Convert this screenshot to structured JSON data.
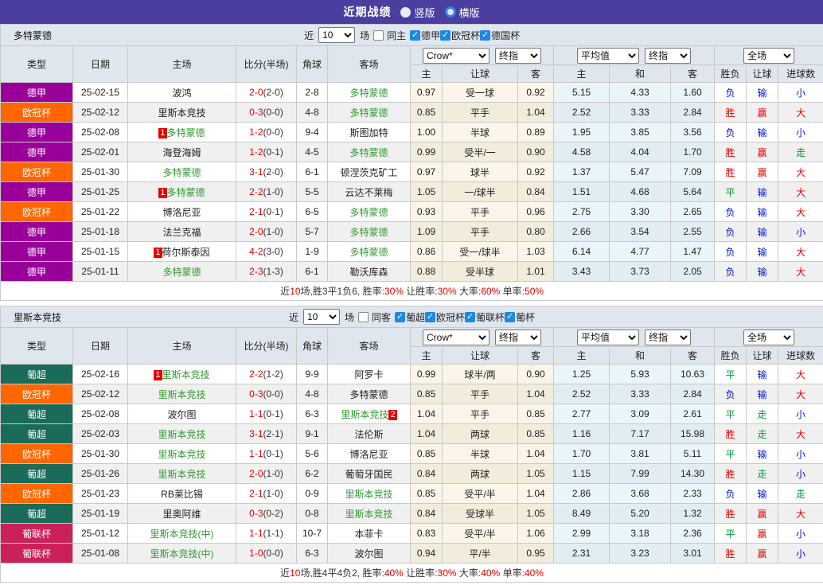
{
  "header": {
    "title": "近期战绩",
    "radios": [
      {
        "label": "竖版",
        "selected": true
      },
      {
        "label": "横版",
        "selected": false
      }
    ]
  },
  "league_colors": {
    "德甲": "#990099",
    "欧冠杯": "#ff6600",
    "葡超": "#1a6b5a",
    "葡联杯": "#cb2158"
  },
  "result_colors": {
    "red": "#e60000",
    "blue": "#0013cc",
    "green": "#009933"
  },
  "columns": {
    "type": "类型",
    "date": "日期",
    "home": "主场",
    "score": "比分(半场)",
    "corner": "角球",
    "away": "客场",
    "h": "主",
    "handicap": "让球",
    "a": "客",
    "avg_h": "主",
    "avg_d": "和",
    "avg_a": "客",
    "result": "胜负",
    "handicap_result": "让球",
    "goals": "进球数"
  },
  "header_selects": {
    "company": "Crow*",
    "company_final": "终指",
    "avg": "平均值",
    "avg_final": "终指",
    "scope": "全场"
  },
  "tables": [
    {
      "team": "多特蒙德",
      "filter": {
        "prefix": "近",
        "count": "10",
        "suffix": "场",
        "same_label": "同主",
        "leagues": [
          {
            "label": "德甲",
            "checked": true
          },
          {
            "label": "欧冠杯",
            "checked": true
          },
          {
            "label": "德国杯",
            "checked": true
          }
        ]
      },
      "rows": [
        {
          "league": "德甲",
          "date": "25-02-15",
          "home": "波鸿",
          "home_green": false,
          "home_badge": "",
          "score": "2-0",
          "half": "(2-0)",
          "corner": "2-8",
          "away": "多特蒙德",
          "away_green": true,
          "away_badge": "",
          "odds": [
            "0.97",
            "受一球",
            "0.92"
          ],
          "avg": [
            "5.15",
            "4.33",
            "1.60"
          ],
          "results": [
            {
              "t": "负",
              "c": "blue"
            },
            {
              "t": "输",
              "c": "blue"
            },
            {
              "t": "小",
              "c": "blue"
            }
          ]
        },
        {
          "league": "欧冠杯",
          "date": "25-02-12",
          "home": "里斯本竞技",
          "home_green": false,
          "home_badge": "",
          "score": "0-3",
          "half": "(0-0)",
          "corner": "4-8",
          "away": "多特蒙德",
          "away_green": true,
          "away_badge": "",
          "odds": [
            "0.85",
            "平手",
            "1.04"
          ],
          "avg": [
            "2.52",
            "3.33",
            "2.84"
          ],
          "results": [
            {
              "t": "胜",
              "c": "red"
            },
            {
              "t": "赢",
              "c": "red"
            },
            {
              "t": "大",
              "c": "red"
            }
          ]
        },
        {
          "league": "德甲",
          "date": "25-02-08",
          "home": "多特蒙德",
          "home_green": true,
          "home_badge": "1",
          "score": "1-2",
          "half": "(0-0)",
          "corner": "9-4",
          "away": "斯图加特",
          "away_green": false,
          "away_badge": "",
          "odds": [
            "1.00",
            "半球",
            "0.89"
          ],
          "avg": [
            "1.95",
            "3.85",
            "3.56"
          ],
          "results": [
            {
              "t": "负",
              "c": "blue"
            },
            {
              "t": "输",
              "c": "blue"
            },
            {
              "t": "小",
              "c": "blue"
            }
          ]
        },
        {
          "league": "德甲",
          "date": "25-02-01",
          "home": "海登海姆",
          "home_green": false,
          "home_badge": "",
          "score": "1-2",
          "half": "(0-1)",
          "corner": "4-5",
          "away": "多特蒙德",
          "away_green": true,
          "away_badge": "",
          "odds": [
            "0.99",
            "受半/一",
            "0.90"
          ],
          "avg": [
            "4.58",
            "4.04",
            "1.70"
          ],
          "results": [
            {
              "t": "胜",
              "c": "red"
            },
            {
              "t": "赢",
              "c": "red"
            },
            {
              "t": "走",
              "c": "green"
            }
          ]
        },
        {
          "league": "欧冠杯",
          "date": "25-01-30",
          "home": "多特蒙德",
          "home_green": true,
          "home_badge": "",
          "score": "3-1",
          "half": "(2-0)",
          "corner": "6-1",
          "away": "顿涅茨克矿工",
          "away_green": false,
          "away_badge": "",
          "odds": [
            "0.97",
            "球半",
            "0.92"
          ],
          "avg": [
            "1.37",
            "5.47",
            "7.09"
          ],
          "results": [
            {
              "t": "胜",
              "c": "red"
            },
            {
              "t": "赢",
              "c": "red"
            },
            {
              "t": "大",
              "c": "red"
            }
          ]
        },
        {
          "league": "德甲",
          "date": "25-01-25",
          "home": "多特蒙德",
          "home_green": true,
          "home_badge": "1",
          "score": "2-2",
          "half": "(1-0)",
          "corner": "5-5",
          "away": "云达不莱梅",
          "away_green": false,
          "away_badge": "",
          "odds": [
            "1.05",
            "一/球半",
            "0.84"
          ],
          "avg": [
            "1.51",
            "4.68",
            "5.64"
          ],
          "results": [
            {
              "t": "平",
              "c": "green"
            },
            {
              "t": "输",
              "c": "blue"
            },
            {
              "t": "大",
              "c": "red"
            }
          ]
        },
        {
          "league": "欧冠杯",
          "date": "25-01-22",
          "home": "博洛尼亚",
          "home_green": false,
          "home_badge": "",
          "score": "2-1",
          "half": "(0-1)",
          "corner": "6-5",
          "away": "多特蒙德",
          "away_green": true,
          "away_badge": "",
          "odds": [
            "0.93",
            "平手",
            "0.96"
          ],
          "avg": [
            "2.75",
            "3.30",
            "2.65"
          ],
          "results": [
            {
              "t": "负",
              "c": "blue"
            },
            {
              "t": "输",
              "c": "blue"
            },
            {
              "t": "大",
              "c": "red"
            }
          ]
        },
        {
          "league": "德甲",
          "date": "25-01-18",
          "home": "法兰克福",
          "home_green": false,
          "home_badge": "",
          "score": "2-0",
          "half": "(1-0)",
          "corner": "5-7",
          "away": "多特蒙德",
          "away_green": true,
          "away_badge": "",
          "odds": [
            "1.09",
            "平手",
            "0.80"
          ],
          "avg": [
            "2.66",
            "3.54",
            "2.55"
          ],
          "results": [
            {
              "t": "负",
              "c": "blue"
            },
            {
              "t": "输",
              "c": "blue"
            },
            {
              "t": "小",
              "c": "blue"
            }
          ]
        },
        {
          "league": "德甲",
          "date": "25-01-15",
          "home": "荷尔斯泰因",
          "home_green": false,
          "home_badge": "1",
          "score": "4-2",
          "half": "(3-0)",
          "corner": "1-9",
          "away": "多特蒙德",
          "away_green": true,
          "away_badge": "",
          "odds": [
            "0.86",
            "受一/球半",
            "1.03"
          ],
          "avg": [
            "6.14",
            "4.77",
            "1.47"
          ],
          "results": [
            {
              "t": "负",
              "c": "blue"
            },
            {
              "t": "输",
              "c": "blue"
            },
            {
              "t": "大",
              "c": "red"
            }
          ]
        },
        {
          "league": "德甲",
          "date": "25-01-11",
          "home": "多特蒙德",
          "home_green": true,
          "home_badge": "",
          "score": "2-3",
          "half": "(1-3)",
          "corner": "6-1",
          "away": "勒沃库森",
          "away_green": false,
          "away_badge": "",
          "odds": [
            "0.88",
            "受半球",
            "1.01"
          ],
          "avg": [
            "3.43",
            "3.73",
            "2.05"
          ],
          "results": [
            {
              "t": "负",
              "c": "blue"
            },
            {
              "t": "输",
              "c": "blue"
            },
            {
              "t": "大",
              "c": "red"
            }
          ]
        }
      ],
      "summary": [
        {
          "t": "近",
          "r": 0
        },
        {
          "t": "10",
          "r": 1
        },
        {
          "t": "场,胜3平1负6, 胜率:",
          "r": 0
        },
        {
          "t": "30%",
          "r": 1
        },
        {
          "t": " 让胜率:",
          "r": 0
        },
        {
          "t": "30%",
          "r": 1
        },
        {
          "t": " 大率:",
          "r": 0
        },
        {
          "t": "60%",
          "r": 1
        },
        {
          "t": " 单率:",
          "r": 0
        },
        {
          "t": "50%",
          "r": 1
        }
      ]
    },
    {
      "team": "里斯本竞技",
      "filter": {
        "prefix": "近",
        "count": "10",
        "suffix": "场",
        "same_label": "同客",
        "leagues": [
          {
            "label": "葡超",
            "checked": true
          },
          {
            "label": "欧冠杯",
            "checked": true
          },
          {
            "label": "葡联杯",
            "checked": true
          },
          {
            "label": "葡杯",
            "checked": true
          }
        ]
      },
      "rows": [
        {
          "league": "葡超",
          "date": "25-02-16",
          "home": "里斯本竞技",
          "home_green": true,
          "home_badge": "1",
          "score": "2-2",
          "half": "(1-2)",
          "corner": "9-9",
          "away": "阿罗卡",
          "away_green": false,
          "away_badge": "",
          "odds": [
            "0.99",
            "球半/两",
            "0.90"
          ],
          "avg": [
            "1.25",
            "5.93",
            "10.63"
          ],
          "results": [
            {
              "t": "平",
              "c": "green"
            },
            {
              "t": "输",
              "c": "blue"
            },
            {
              "t": "大",
              "c": "red"
            }
          ]
        },
        {
          "league": "欧冠杯",
          "date": "25-02-12",
          "home": "里斯本竞技",
          "home_green": true,
          "home_badge": "",
          "score": "0-3",
          "half": "(0-0)",
          "corner": "4-8",
          "away": "多特蒙德",
          "away_green": false,
          "away_badge": "",
          "odds": [
            "0.85",
            "平手",
            "1.04"
          ],
          "avg": [
            "2.52",
            "3.33",
            "2.84"
          ],
          "results": [
            {
              "t": "负",
              "c": "blue"
            },
            {
              "t": "输",
              "c": "blue"
            },
            {
              "t": "大",
              "c": "red"
            }
          ]
        },
        {
          "league": "葡超",
          "date": "25-02-08",
          "home": "波尔图",
          "home_green": false,
          "home_badge": "",
          "score": "1-1",
          "half": "(0-1)",
          "corner": "6-3",
          "away": "里斯本竞技",
          "away_green": true,
          "away_badge": "2",
          "odds": [
            "1.04",
            "平手",
            "0.85"
          ],
          "avg": [
            "2.77",
            "3.09",
            "2.61"
          ],
          "results": [
            {
              "t": "平",
              "c": "green"
            },
            {
              "t": "走",
              "c": "green"
            },
            {
              "t": "小",
              "c": "blue"
            }
          ]
        },
        {
          "league": "葡超",
          "date": "25-02-03",
          "home": "里斯本竞技",
          "home_green": true,
          "home_badge": "",
          "score": "3-1",
          "half": "(2-1)",
          "corner": "9-1",
          "away": "法伦斯",
          "away_green": false,
          "away_badge": "",
          "odds": [
            "1.04",
            "两球",
            "0.85"
          ],
          "avg": [
            "1.16",
            "7.17",
            "15.98"
          ],
          "results": [
            {
              "t": "胜",
              "c": "red"
            },
            {
              "t": "走",
              "c": "green"
            },
            {
              "t": "大",
              "c": "red"
            }
          ]
        },
        {
          "league": "欧冠杯",
          "date": "25-01-30",
          "home": "里斯本竞技",
          "home_green": true,
          "home_badge": "",
          "score": "1-1",
          "half": "(0-1)",
          "corner": "5-6",
          "away": "博洛尼亚",
          "away_green": false,
          "away_badge": "",
          "odds": [
            "0.85",
            "半球",
            "1.04"
          ],
          "avg": [
            "1.70",
            "3.81",
            "5.11"
          ],
          "results": [
            {
              "t": "平",
              "c": "green"
            },
            {
              "t": "输",
              "c": "blue"
            },
            {
              "t": "小",
              "c": "blue"
            }
          ]
        },
        {
          "league": "葡超",
          "date": "25-01-26",
          "home": "里斯本竞技",
          "home_green": true,
          "home_badge": "",
          "score": "2-0",
          "half": "(1-0)",
          "corner": "6-2",
          "away": "葡萄牙国民",
          "away_green": false,
          "away_badge": "",
          "odds": [
            "0.84",
            "两球",
            "1.05"
          ],
          "avg": [
            "1.15",
            "7.99",
            "14.30"
          ],
          "results": [
            {
              "t": "胜",
              "c": "red"
            },
            {
              "t": "走",
              "c": "green"
            },
            {
              "t": "小",
              "c": "blue"
            }
          ]
        },
        {
          "league": "欧冠杯",
          "date": "25-01-23",
          "home": "RB莱比锡",
          "home_green": false,
          "home_badge": "",
          "score": "2-1",
          "half": "(1-0)",
          "corner": "0-9",
          "away": "里斯本竞技",
          "away_green": true,
          "away_badge": "",
          "odds": [
            "0.85",
            "受平/半",
            "1.04"
          ],
          "avg": [
            "2.86",
            "3.68",
            "2.33"
          ],
          "results": [
            {
              "t": "负",
              "c": "blue"
            },
            {
              "t": "输",
              "c": "blue"
            },
            {
              "t": "走",
              "c": "green"
            }
          ]
        },
        {
          "league": "葡超",
          "date": "25-01-19",
          "home": "里奥阿维",
          "home_green": false,
          "home_badge": "",
          "score": "0-3",
          "half": "(0-2)",
          "corner": "0-8",
          "away": "里斯本竞技",
          "away_green": true,
          "away_badge": "",
          "odds": [
            "0.84",
            "受球半",
            "1.05"
          ],
          "avg": [
            "8.49",
            "5.20",
            "1.32"
          ],
          "results": [
            {
              "t": "胜",
              "c": "red"
            },
            {
              "t": "赢",
              "c": "red"
            },
            {
              "t": "大",
              "c": "red"
            }
          ]
        },
        {
          "league": "葡联杯",
          "date": "25-01-12",
          "home": "里斯本竞技(中)",
          "home_green": true,
          "home_badge": "",
          "score": "1-1",
          "half": "(1-1)",
          "corner": "10-7",
          "away": "本菲卡",
          "away_green": false,
          "away_badge": "",
          "odds": [
            "0.83",
            "受平/半",
            "1.06"
          ],
          "avg": [
            "2.99",
            "3.18",
            "2.36"
          ],
          "results": [
            {
              "t": "平",
              "c": "green"
            },
            {
              "t": "赢",
              "c": "red"
            },
            {
              "t": "小",
              "c": "blue"
            }
          ]
        },
        {
          "league": "葡联杯",
          "date": "25-01-08",
          "home": "里斯本竞技(中)",
          "home_green": true,
          "home_badge": "",
          "score": "1-0",
          "half": "(0-0)",
          "corner": "6-3",
          "away": "波尔图",
          "away_green": false,
          "away_badge": "",
          "odds": [
            "0.94",
            "平/半",
            "0.95"
          ],
          "avg": [
            "2.31",
            "3.23",
            "3.01"
          ],
          "results": [
            {
              "t": "胜",
              "c": "red"
            },
            {
              "t": "赢",
              "c": "red"
            },
            {
              "t": "小",
              "c": "blue"
            }
          ]
        }
      ],
      "summary": [
        {
          "t": "近",
          "r": 0
        },
        {
          "t": "10",
          "r": 1
        },
        {
          "t": "场,胜4平4负2, 胜率:",
          "r": 0
        },
        {
          "t": "40%",
          "r": 1
        },
        {
          "t": " 让胜率:",
          "r": 0
        },
        {
          "t": "30%",
          "r": 1
        },
        {
          "t": " 大率:",
          "r": 0
        },
        {
          "t": "40%",
          "r": 1
        },
        {
          "t": " 单率:",
          "r": 0
        },
        {
          "t": "40%",
          "r": 1
        }
      ]
    }
  ]
}
